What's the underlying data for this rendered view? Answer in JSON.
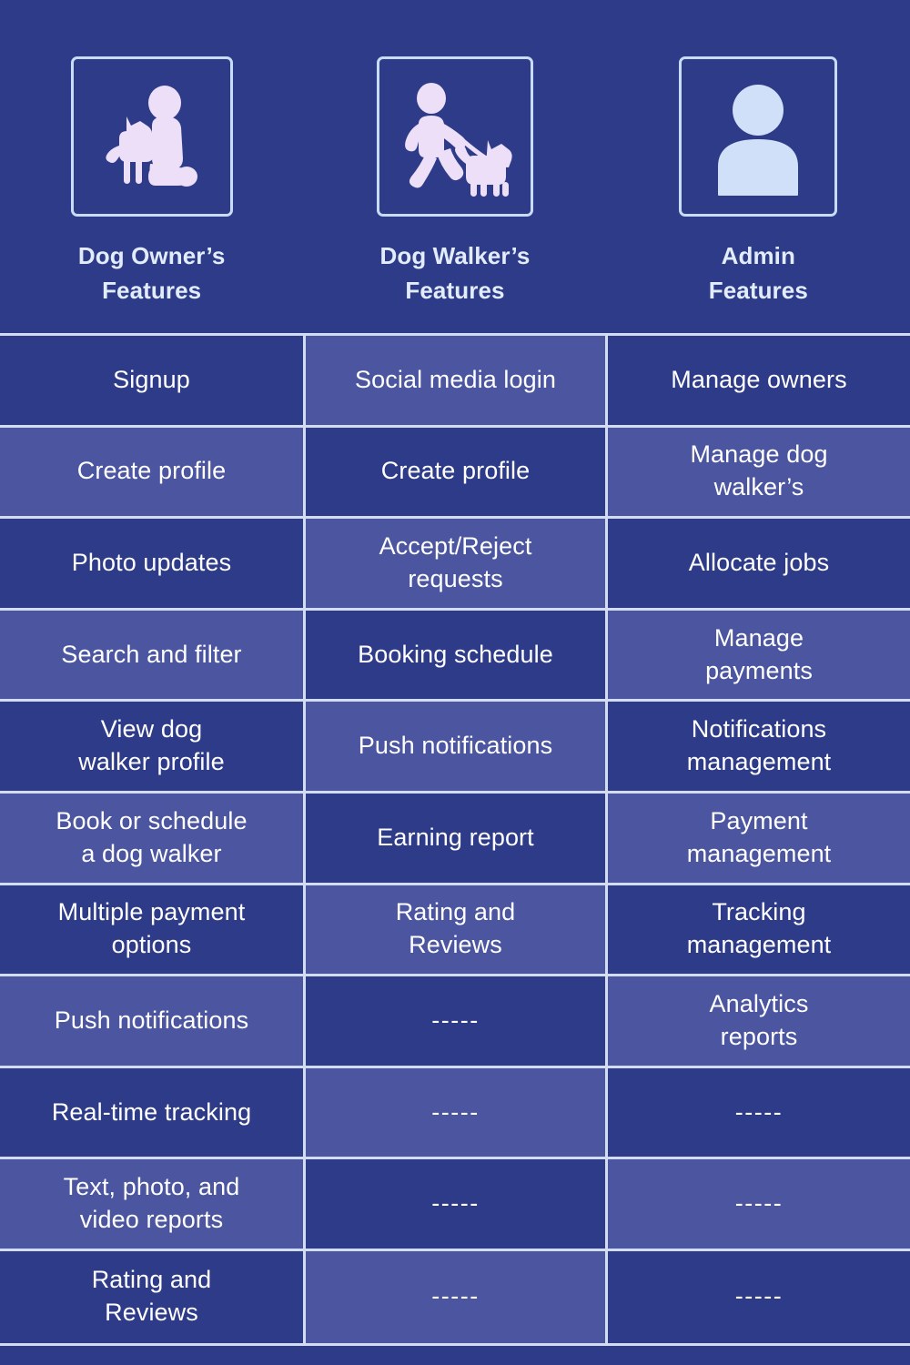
{
  "header": {
    "columns": [
      {
        "icon": "dog-owner-icon",
        "label": "Dog Owner’s\nFeatures"
      },
      {
        "icon": "dog-walker-icon",
        "label": "Dog Walker’s\nFeatures"
      },
      {
        "icon": "admin-user-icon",
        "label": "Admin\nFeatures"
      }
    ]
  },
  "colors": {
    "background": "#2e3b89",
    "cell_dark": "#2e3b89",
    "cell_light": "#4b55a0",
    "border": "#d3ddf2",
    "header_text": "#e2ecfb",
    "cell_text": "#ffffff",
    "icon_lavender": "#ecdff7",
    "icon_blue": "#cfe0f8"
  },
  "table": {
    "rows": [
      {
        "owner": "Signup",
        "walker": "Social media login",
        "admin": "Manage owners"
      },
      {
        "owner": "Create profile",
        "walker": "Create profile",
        "admin": "Manage dog\nwalker’s"
      },
      {
        "owner": "Photo updates",
        "walker": "Accept/Reject\nrequests",
        "admin": "Allocate jobs"
      },
      {
        "owner": "Search and filter",
        "walker": "Booking schedule",
        "admin": "Manage\npayments"
      },
      {
        "owner": "View dog\nwalker profile",
        "walker": "Push notifications",
        "admin": "Notifications\nmanagement"
      },
      {
        "owner": "Book or schedule\na dog walker",
        "walker": "Earning report",
        "admin": "Payment\nmanagement"
      },
      {
        "owner": "Multiple payment\noptions",
        "walker": "Rating and\nReviews",
        "admin": "Tracking\nmanagement"
      },
      {
        "owner": "Push notifications",
        "walker": "-----",
        "admin": "Analytics\nreports"
      },
      {
        "owner": "Real-time tracking",
        "walker": "-----",
        "admin": "-----"
      },
      {
        "owner": "Text, photo, and\nvideo reports",
        "walker": "-----",
        "admin": "-----"
      },
      {
        "owner": "Rating and\nReviews",
        "walker": "-----",
        "admin": "-----"
      }
    ]
  }
}
